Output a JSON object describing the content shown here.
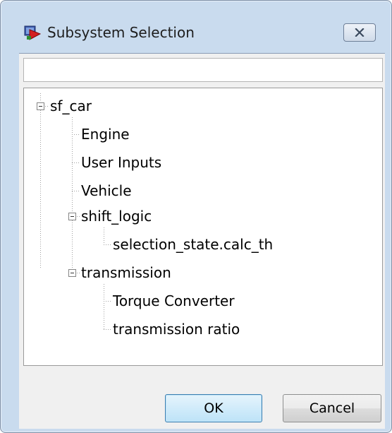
{
  "window": {
    "title": "Subsystem Selection",
    "app_icon": "simulink-model-icon",
    "close_icon": "close-x-icon"
  },
  "search": {
    "value": "",
    "placeholder": ""
  },
  "tree": {
    "root": {
      "label": "sf_car",
      "expanded": true
    },
    "children": [
      {
        "label": "Engine"
      },
      {
        "label": "User Inputs"
      },
      {
        "label": "Vehicle"
      },
      {
        "label": "shift_logic",
        "expanded": true
      },
      {
        "label": "selection_state.calc_th"
      },
      {
        "label": "transmission",
        "expanded": true
      },
      {
        "label": "Torque Converter"
      },
      {
        "label": "transmission ratio"
      }
    ]
  },
  "buttons": {
    "ok": "OK",
    "cancel": "Cancel"
  },
  "colors": {
    "frame": "#c9dbee",
    "client": "#f0f0f0",
    "ok_accent": "#3c7fb1"
  }
}
